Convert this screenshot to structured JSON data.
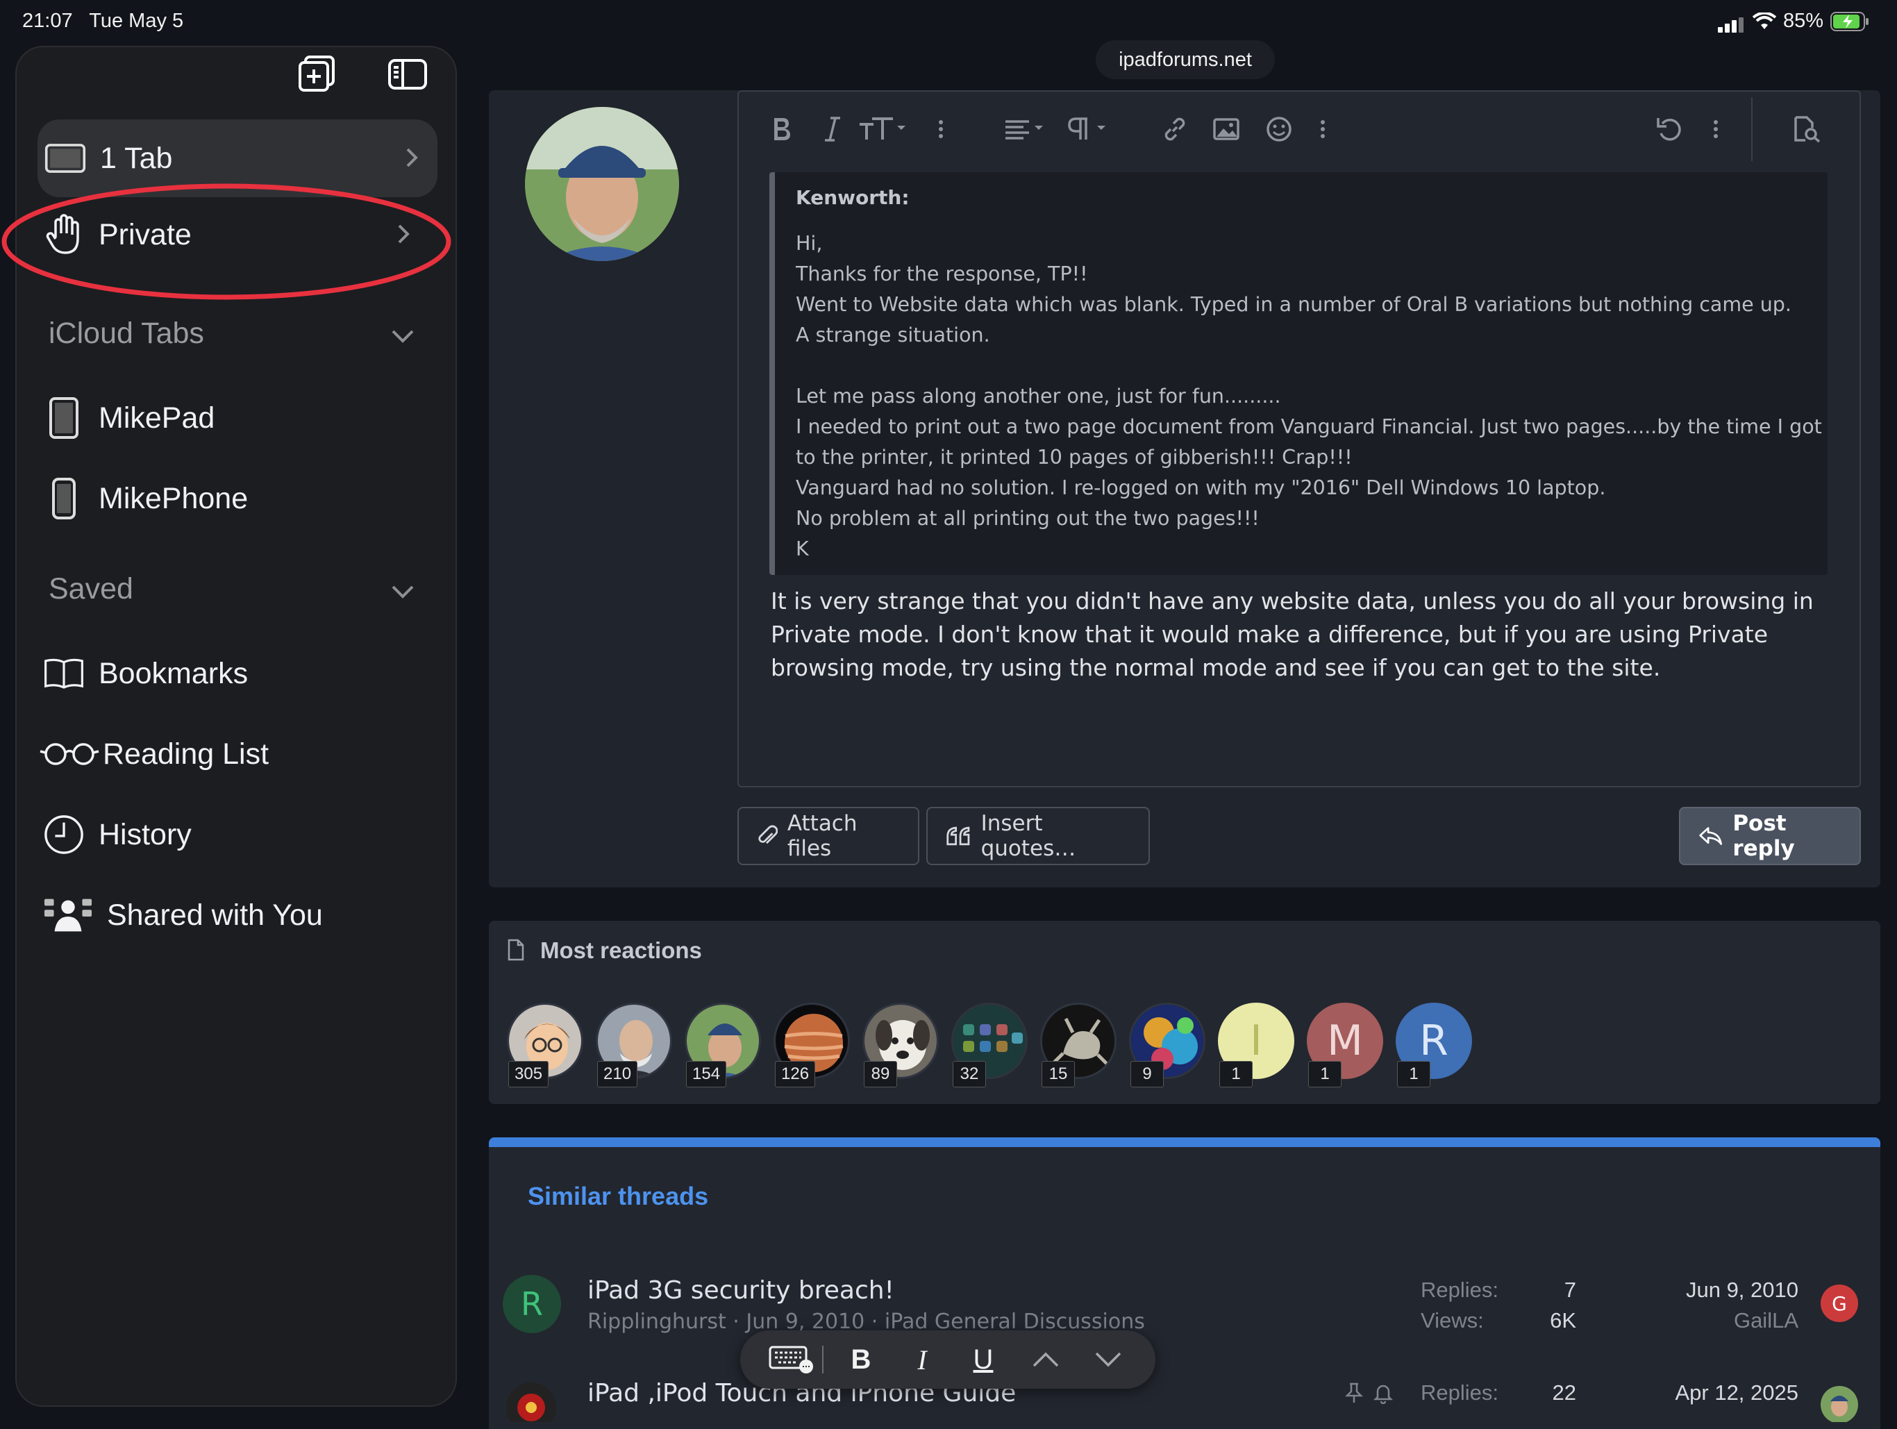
{
  "status_bar": {
    "time": "21:07",
    "date": "Tue May 5",
    "battery": "85%"
  },
  "sidebar": {
    "tab_group": {
      "label": "1 Tab"
    },
    "private": {
      "label": "Private"
    },
    "icloud_section": {
      "label": "iCloud Tabs",
      "devices": [
        "MikePad",
        "MikePhone"
      ]
    },
    "saved_section": {
      "label": "Saved",
      "items": [
        "Bookmarks",
        "Reading List",
        "History",
        "Shared with You"
      ]
    },
    "highlight_color": "#e8313f"
  },
  "address_bar": {
    "domain": "ipadforums.net"
  },
  "editor": {
    "quote_author": "Kenworth:",
    "quote_paragraphs": [
      [
        "Hi,",
        "Thanks for the response, TP!!",
        "Went to Website data which was blank. Typed in a number of Oral B variations but nothing came up.",
        "A strange situation."
      ],
      [
        "Let me pass along another one, just for fun.........",
        "I needed to print out a two page document from Vanguard Financial. Just two pages.....by the time I got",
        "to the printer, it printed 10 pages of gibberish!!! Crap!!!",
        "Vanguard had no solution. I re-logged on with my \"2016\" Dell Windows 10 laptop.",
        "No problem at all printing out the two pages!!!",
        "K"
      ]
    ],
    "reply_text": "It is very strange that you didn't have any website data, unless you do all your browsing in Private mode. I don't know that it would make a difference, but if you are using Private browsing mode, try using the normal mode and see if you can get to the site.",
    "attach_label": "Attach files",
    "insert_quotes_label": "Insert quotes…",
    "post_reply_label": "Post reply"
  },
  "reactions": {
    "title": "Most reactions",
    "users": [
      {
        "count": "305"
      },
      {
        "count": "210"
      },
      {
        "count": "154"
      },
      {
        "count": "126"
      },
      {
        "count": "89"
      },
      {
        "count": "32"
      },
      {
        "count": "15"
      },
      {
        "count": "9"
      },
      {
        "letter": "I",
        "count": "1",
        "color": "#e9eaa8"
      },
      {
        "letter": "M",
        "count": "1",
        "color": "#a55c5c"
      },
      {
        "letter": "R",
        "count": "1",
        "color": "#3f6fb5"
      }
    ]
  },
  "similar_threads": {
    "title": "Similar threads",
    "threads": [
      {
        "avatar_letter": "R",
        "title": "iPad 3G security breach!",
        "meta": "Ripplinghurst · Jun 9, 2010 · iPad General Discussions",
        "replies_label": "Replies:",
        "replies": "7",
        "views_label": "Views:",
        "views": "6K",
        "last_date": "Jun 9, 2010",
        "last_user": "GailLA",
        "last_avatar_letter": "G"
      },
      {
        "title": "iPad ,iPod Touch and iPhone Guide",
        "replies_label": "Replies:",
        "replies": "22",
        "last_date": "Apr 12, 2025"
      }
    ]
  },
  "keyboard_bar": {
    "bold": "B",
    "italic": "I",
    "underline": "U"
  }
}
